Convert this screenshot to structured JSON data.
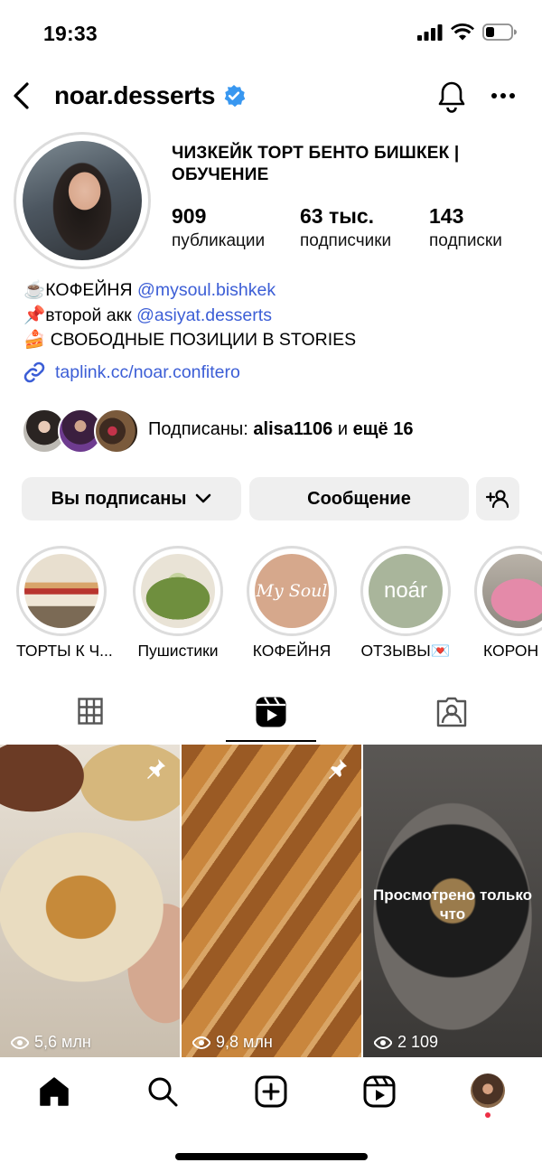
{
  "status": {
    "time": "19:33"
  },
  "profile": {
    "username": "noar.desserts",
    "full_name": "ЧИЗКЕЙК ТОРТ БЕНТО БИШКЕК | ОБУЧЕНИЕ",
    "stats": [
      {
        "value": "909",
        "label": "публикации"
      },
      {
        "value": "63 тыс.",
        "label": "подписчики"
      },
      {
        "value": "143",
        "label": "подписки"
      }
    ],
    "bio": {
      "line1_prefix": "☕️КОФЕЙНЯ ",
      "line1_link": "@mysoul.bishkek",
      "line2_prefix": "📌второй акк ",
      "line2_link": "@asiyat.desserts",
      "line3": "🍰 СВОБОДНЫЕ ПОЗИЦИИ В STORIES"
    },
    "link": "taplink.cc/noar.confitero",
    "followed_by": {
      "prefix": "Подписаны: ",
      "user": "alisa1106",
      "middle": " и ",
      "rest": "ещё 16"
    }
  },
  "actions": {
    "following_label": "Вы подписаны",
    "message_label": "Сообщение"
  },
  "highlights": [
    {
      "label": "ТОРТЫ К Ч...",
      "color": "#c98d6a"
    },
    {
      "label": "Пушистики",
      "color": "#6f8f3e"
    },
    {
      "label": "КОФЕЙНЯ",
      "color": "#d6a88c",
      "text": "My Soul"
    },
    {
      "label": "ОТЗЫВЫ💌",
      "color": "#a9b59b",
      "text": "noár"
    },
    {
      "label": "КОРОН",
      "color": "#e3a3b6"
    }
  ],
  "tabs": [
    "grid",
    "reels",
    "tagged"
  ],
  "reels": [
    {
      "views": "5,6 млн",
      "pinned": true
    },
    {
      "views": "9,8 млн",
      "pinned": true
    },
    {
      "views": "2 109",
      "pinned": false,
      "overlay": "Просмотрено только что"
    }
  ],
  "nav": [
    "home",
    "search",
    "create",
    "reels",
    "profile"
  ]
}
